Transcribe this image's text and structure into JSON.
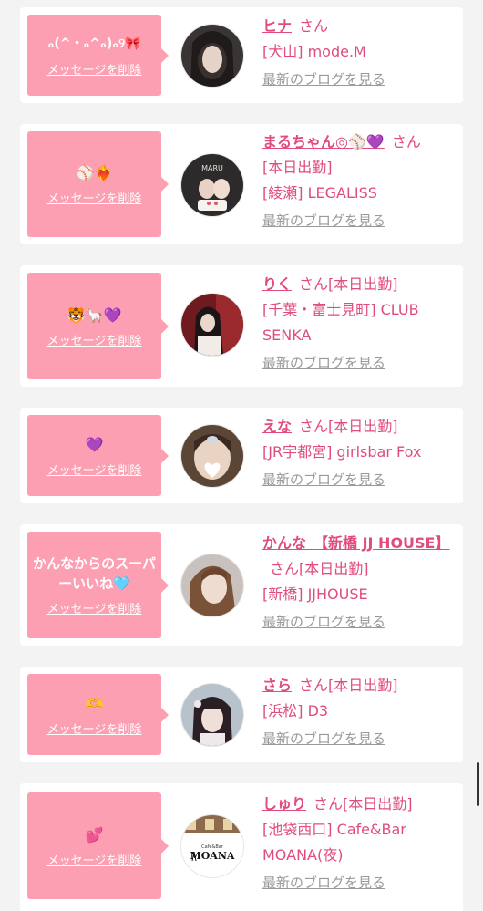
{
  "common": {
    "delete_label": "メッセージを削除",
    "blog_label": "最新のブログを見る",
    "san": "さん"
  },
  "colors": {
    "bubble": "#fd9fb2",
    "accent": "#e04c7b",
    "blog_link": "#9a9a9a",
    "background": "#f3f3f3"
  },
  "messages": [
    {
      "message": "ₒ(^・ₒ^ₒ)ₒ୨🎀",
      "name": "ヒナ",
      "status": "",
      "shop_line1": "[犬山] mode.M",
      "shop_line2": ""
    },
    {
      "message": "⚾❤️‍🔥",
      "name": "まるちゃん◎⚾💜",
      "status": "[本日出勤]",
      "shop_line1": "[綾瀬] LEGALISS",
      "shop_line2": ""
    },
    {
      "message": "🐯🦙💜",
      "name": "りく",
      "status": "[本日出勤]",
      "shop_line1": "[千葉・富士見町] CLUB",
      "shop_line2": "SENKA"
    },
    {
      "message": "💜",
      "name": "えな",
      "status": "[本日出勤]",
      "shop_line1": "[JR宇都宮] girlsbar Fox",
      "shop_line2": ""
    },
    {
      "message": "かんなからのスーパーいいね🩵",
      "name": "かんな　【新橋 JJ HOUSE】",
      "status": "[本日出勤]",
      "shop_line1": "[新橋] JJHOUSE",
      "shop_line2": ""
    },
    {
      "message": "🫶",
      "name": "さら",
      "status": "[本日出勤]",
      "shop_line1": "[浜松] D3",
      "shop_line2": ""
    },
    {
      "message": "💕",
      "name": "しゅり",
      "status": "[本日出勤]",
      "shop_line1": "[池袋西口] Cafe&Bar",
      "shop_line2": "MOANA(夜)"
    }
  ],
  "avatar_text": {
    "maru": "MARU",
    "moana_small": "Cafe&Bar",
    "moana": "MOANA"
  }
}
